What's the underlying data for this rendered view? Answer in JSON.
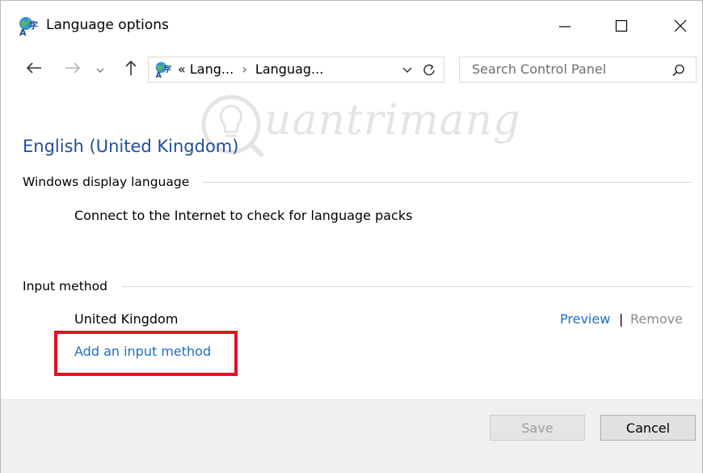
{
  "window": {
    "title": "Language options",
    "icon": "language-globe-icon"
  },
  "nav": {
    "address": {
      "prefix": "«",
      "crumbs": [
        "Lang...",
        "Languag..."
      ],
      "separator": "›"
    },
    "search": {
      "placeholder": "Search Control Panel"
    }
  },
  "main": {
    "heading": "English (United Kingdom)",
    "display_language": {
      "title": "Windows display language",
      "message": "Connect to the Internet to check for language packs"
    },
    "input_method": {
      "title": "Input method",
      "item": "United Kingdom",
      "preview_label": "Preview",
      "separator": "|",
      "remove_label": "Remove",
      "add_label": "Add an input method"
    }
  },
  "footer": {
    "save_label": "Save",
    "cancel_label": "Cancel"
  },
  "colors": {
    "heading": "#1f4e99",
    "link": "#1a6ec8",
    "highlight_border": "#e3101f",
    "footer_bg": "#f0f0f0"
  }
}
